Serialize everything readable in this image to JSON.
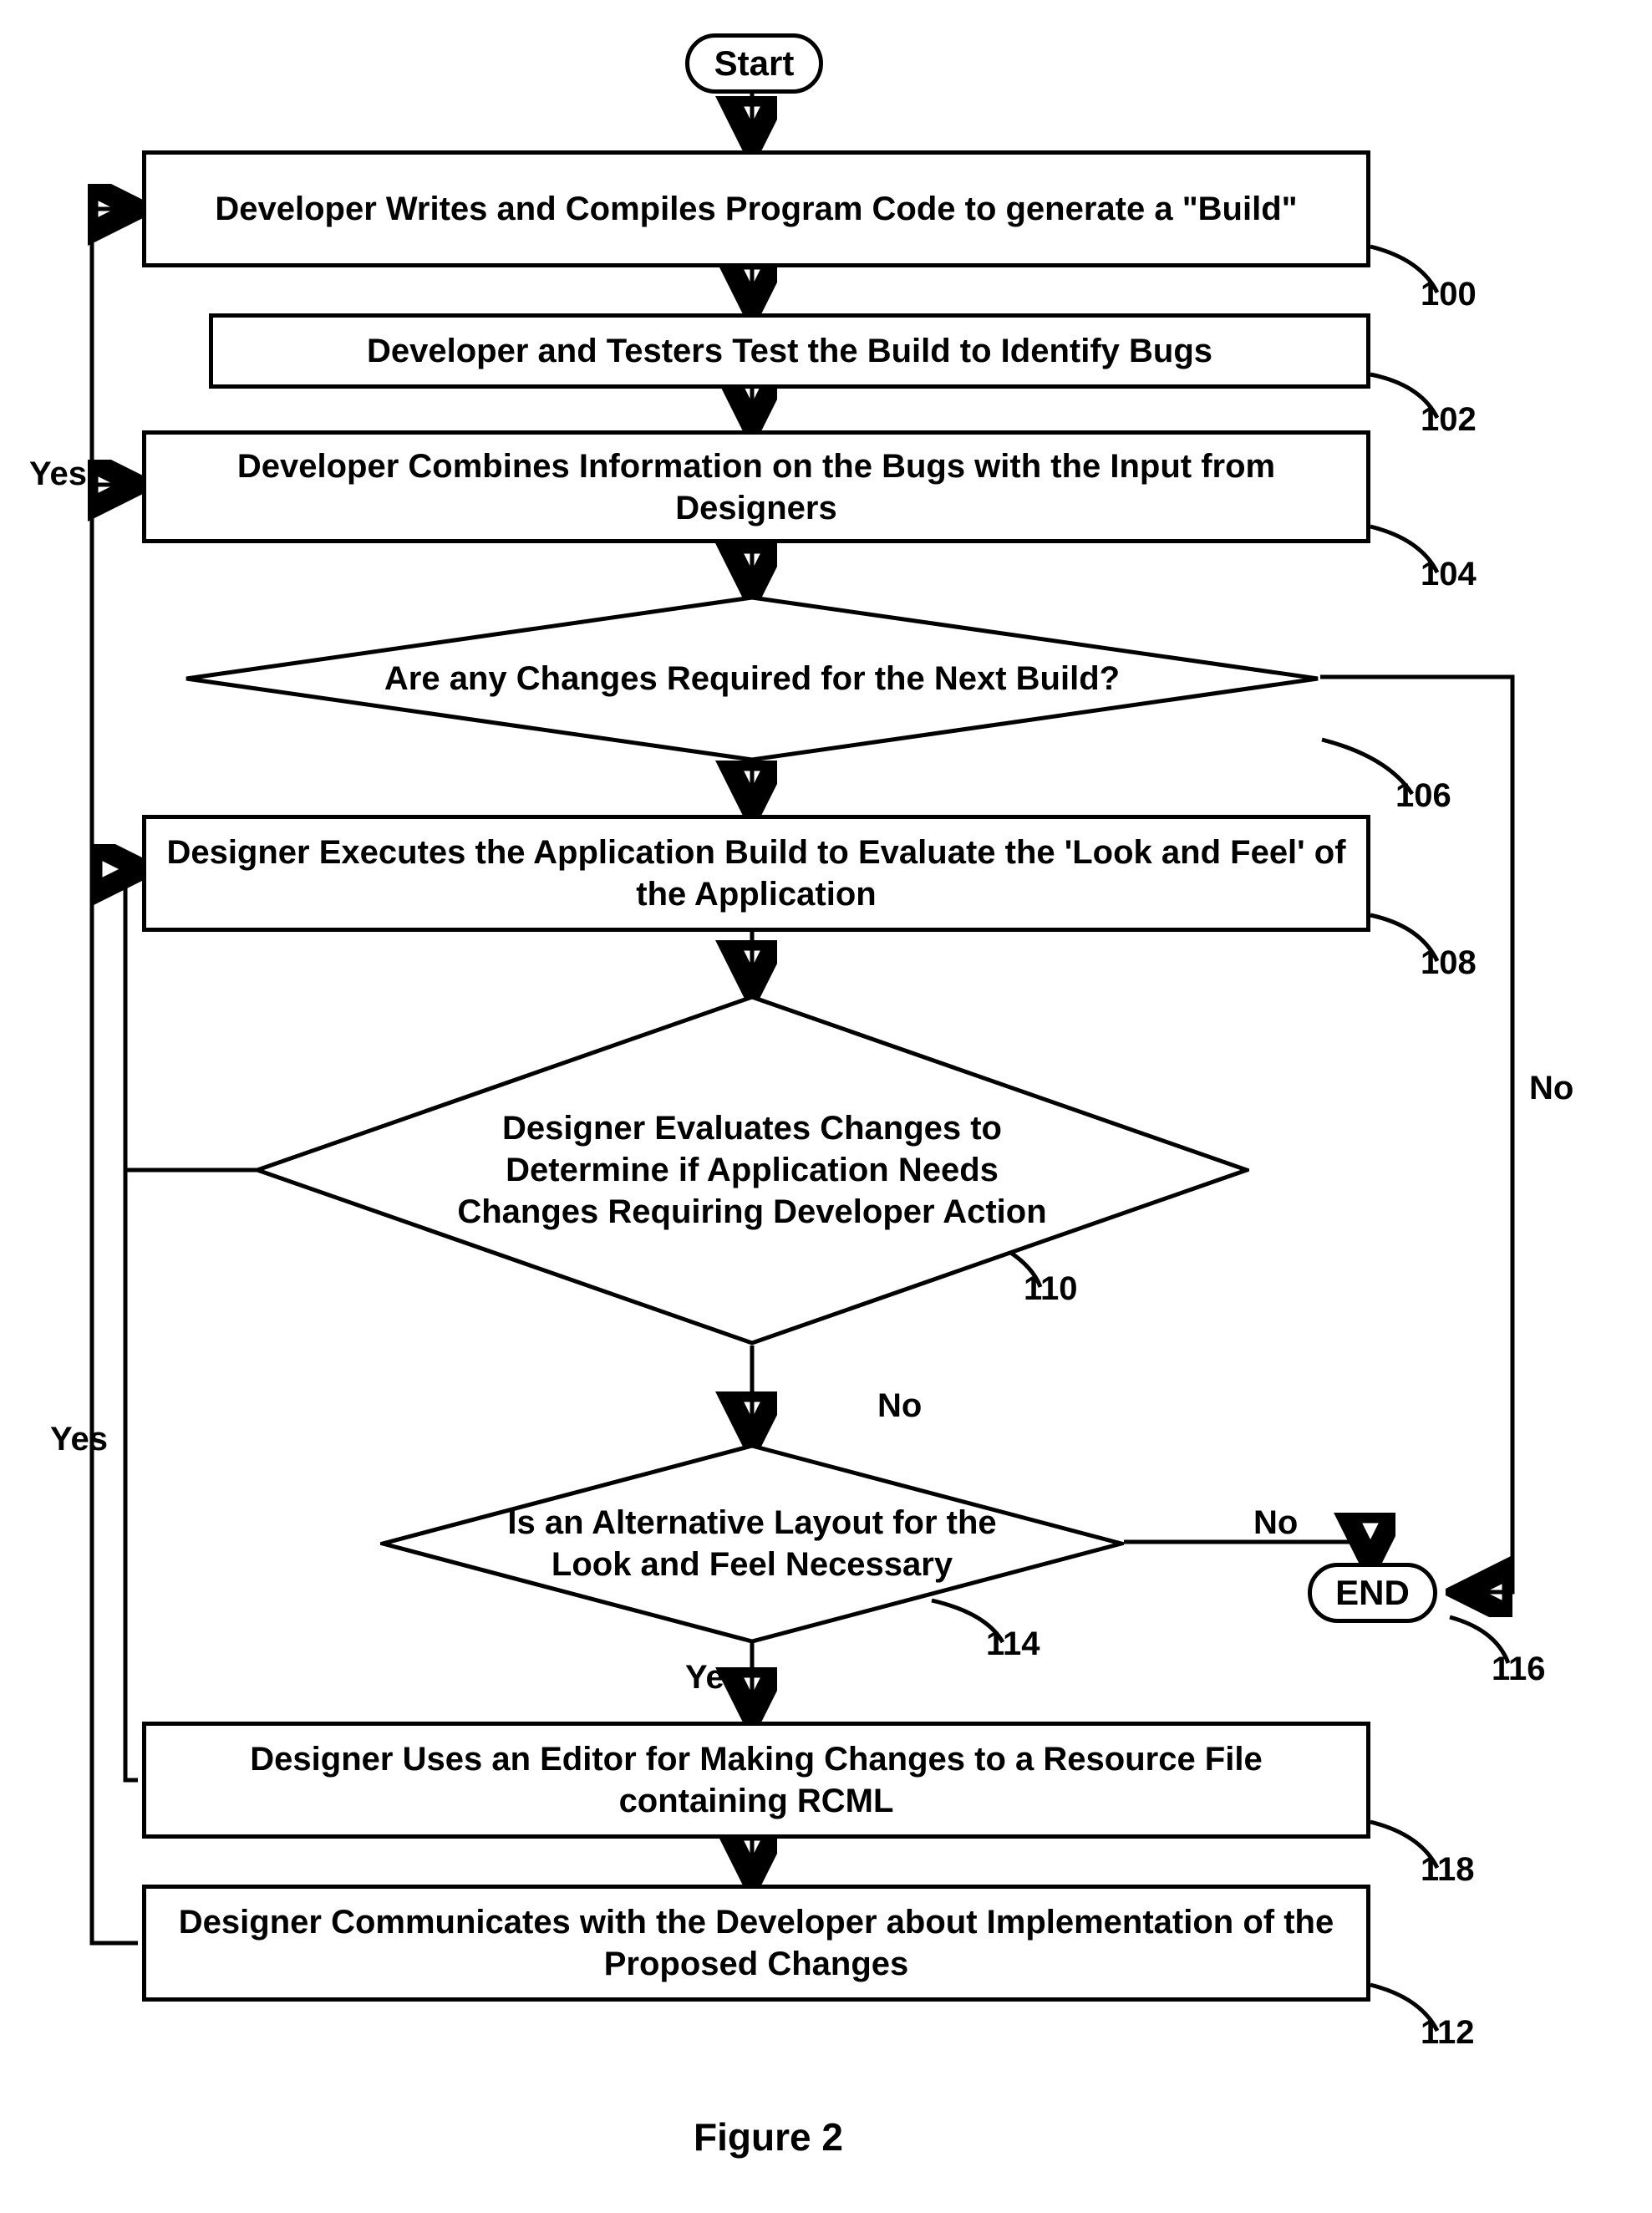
{
  "start": {
    "text": "Start"
  },
  "end": {
    "text": "END"
  },
  "steps": {
    "s100": {
      "text": "Developer Writes and Compiles Program Code  to generate a \"Build\"",
      "ref": "100"
    },
    "s102": {
      "text": "Developer and Testers Test the Build to Identify Bugs",
      "ref": "102"
    },
    "s104": {
      "text": "Developer Combines Information on the Bugs with the Input from Designers",
      "ref": "104"
    },
    "s108": {
      "text": "Designer Executes the Application Build to Evaluate the 'Look and Feel' of the Application",
      "ref": "108"
    },
    "s118": {
      "text": "Designer Uses an Editor for Making Changes to a Resource File containing RCML",
      "ref": "118"
    },
    "s112": {
      "text": "Designer Communicates with the Developer about Implementation of the Proposed Changes",
      "ref": "112"
    }
  },
  "decisions": {
    "d106": {
      "text": "Are any Changes Required for the Next Build?",
      "ref": "106"
    },
    "d110": {
      "text": "Designer Evaluates Changes to Determine if Application Needs Changes Requiring Developer Action",
      "ref": "110"
    },
    "d114": {
      "text": "Is an Alternative Layout for the Look and Feel Necessary",
      "ref": "114"
    }
  },
  "labels": {
    "yes": "Yes",
    "no": "No"
  },
  "figure": "Figure 2",
  "end_ref": "116"
}
